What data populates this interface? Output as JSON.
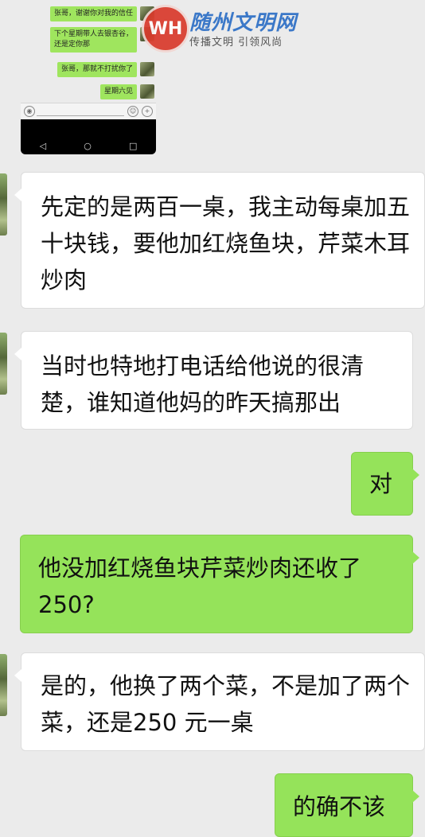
{
  "embedded_screenshot": {
    "messages": [
      {
        "text": "张哥，谢谢你对我的信任"
      },
      {
        "text": "下个星期带人去银杏谷，\n还是定你那"
      },
      {
        "text": "张哥，那就不打扰你了"
      },
      {
        "text": "星期六见"
      },
      {
        "text": "☆ ▲"
      }
    ],
    "nav": {
      "back": "◁",
      "home": "○",
      "recent": "□"
    }
  },
  "watermark": {
    "logo_text": "WH",
    "title": "随州文明网",
    "subtitle": "传播文明  引领风尚"
  },
  "chat": {
    "messages": [
      {
        "side": "left",
        "text": "先定的是两百一桌，我主动每桌加五十块钱，要他加红烧鱼块，芹菜木耳炒肉"
      },
      {
        "side": "left",
        "text": "当时也特地打电话给他说的很清楚，谁知道他妈的昨天搞那出"
      },
      {
        "side": "right",
        "text": "对"
      },
      {
        "side": "right",
        "text": "他没加红烧鱼块芹菜炒肉还收了250?"
      },
      {
        "side": "left",
        "text": "是的，他换了两个菜，不是加了两个菜，还是250 元一桌"
      },
      {
        "side": "right",
        "text": "的确不该"
      }
    ]
  }
}
